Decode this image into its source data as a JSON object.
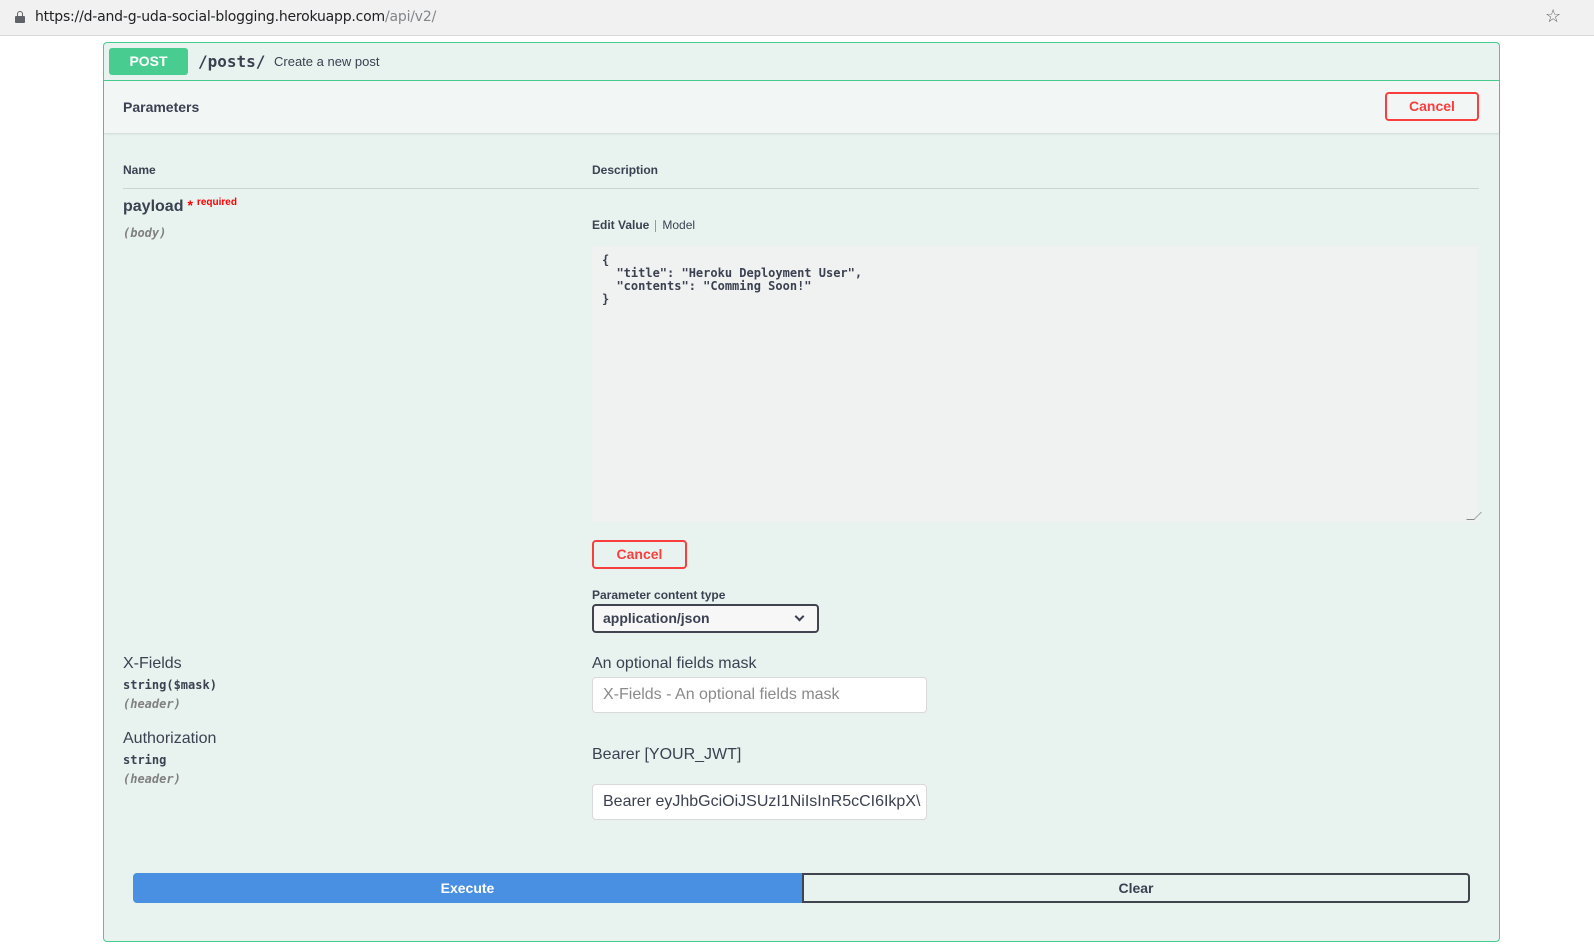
{
  "browser": {
    "url_host": "https://d-and-g-uda-social-blogging.herokuapp.com",
    "url_path": "/api/v2/"
  },
  "operation": {
    "method": "POST",
    "path": "/posts/",
    "summary": "Create a new post"
  },
  "parameters_section": {
    "title": "Parameters",
    "cancel_label": "Cancel",
    "col_name": "Name",
    "col_description": "Description"
  },
  "payload": {
    "name": "payload",
    "required_star": "*",
    "required_label": "required",
    "in": "(body)",
    "tab_edit": "Edit Value",
    "tab_model": "Model",
    "body_value": "{\n  \"title\": \"Heroku Deployment User\",\n  \"contents\": \"Comming Soon!\"\n}",
    "cancel_label": "Cancel",
    "content_type_label": "Parameter content type",
    "content_type_value": "application/json"
  },
  "xfields": {
    "name": "X-Fields",
    "type": "string($mask)",
    "in": "(header)",
    "description": "An optional fields mask",
    "placeholder": "X-Fields - An optional fields mask"
  },
  "authorization": {
    "name": "Authorization",
    "type": "string",
    "in": "(header)",
    "description": "Bearer [YOUR_JWT]",
    "value": "Bearer eyJhbGciOiJSUzI1NiIsInR5cCI6IkpX\\"
  },
  "actions": {
    "execute_label": "Execute",
    "clear_label": "Clear"
  }
}
